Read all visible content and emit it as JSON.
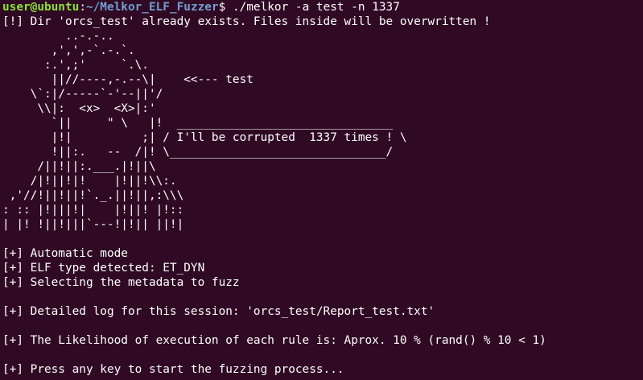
{
  "colors": {
    "background": "#300a24",
    "text": "#ffffff",
    "prompt_user": "#8ae234",
    "prompt_path": "#729fcf"
  },
  "prompt": {
    "user_host": "user@ubuntu",
    "separator": ":",
    "path": "~/Melkor_ELF_Fuzzer",
    "symbol": "$ ",
    "command": "./melkor -a test -n 1337"
  },
  "output_lines": [
    "[!] Dir 'orcs_test' already exists. Files inside will be overwritten !",
    "         ..-.-..",
    "       ,',',-`.-.`.",
    "      :.',;'     `.\\.",
    "       ||//----,-.--\\|    <<--- test",
    "    \\`:|/-----`-'--||'/",
    "     \\\\|:  <x>  <X>|:'",
    "       `||     \" \\   |!  _______________________________",
    "       |!|          ;| / I'll be corrupted  1337 times ! \\",
    "       !||:.   --  /|! \\_______________________________/",
    "     /||!||:.___.|!||\\",
    "    /|!||!|!    |!||!\\\\:.",
    " ,'//!||!||!`._.||!||,:\\\\\\",
    ": :: |!|||!|    |!||! |!::",
    "| |! !||!|||`---!|!|| ||!|",
    "",
    "[+] Automatic mode",
    "[+] ELF type detected: ET_DYN",
    "[+] Selecting the metadata to fuzz",
    "",
    "[+] Detailed log for this session: 'orcs_test/Report_test.txt'",
    "",
    "[+] The Likelihood of execution of each rule is: Aprox. 10 % (rand() % 10 < 1)",
    "",
    "[+] Press any key to start the fuzzing process..."
  ]
}
